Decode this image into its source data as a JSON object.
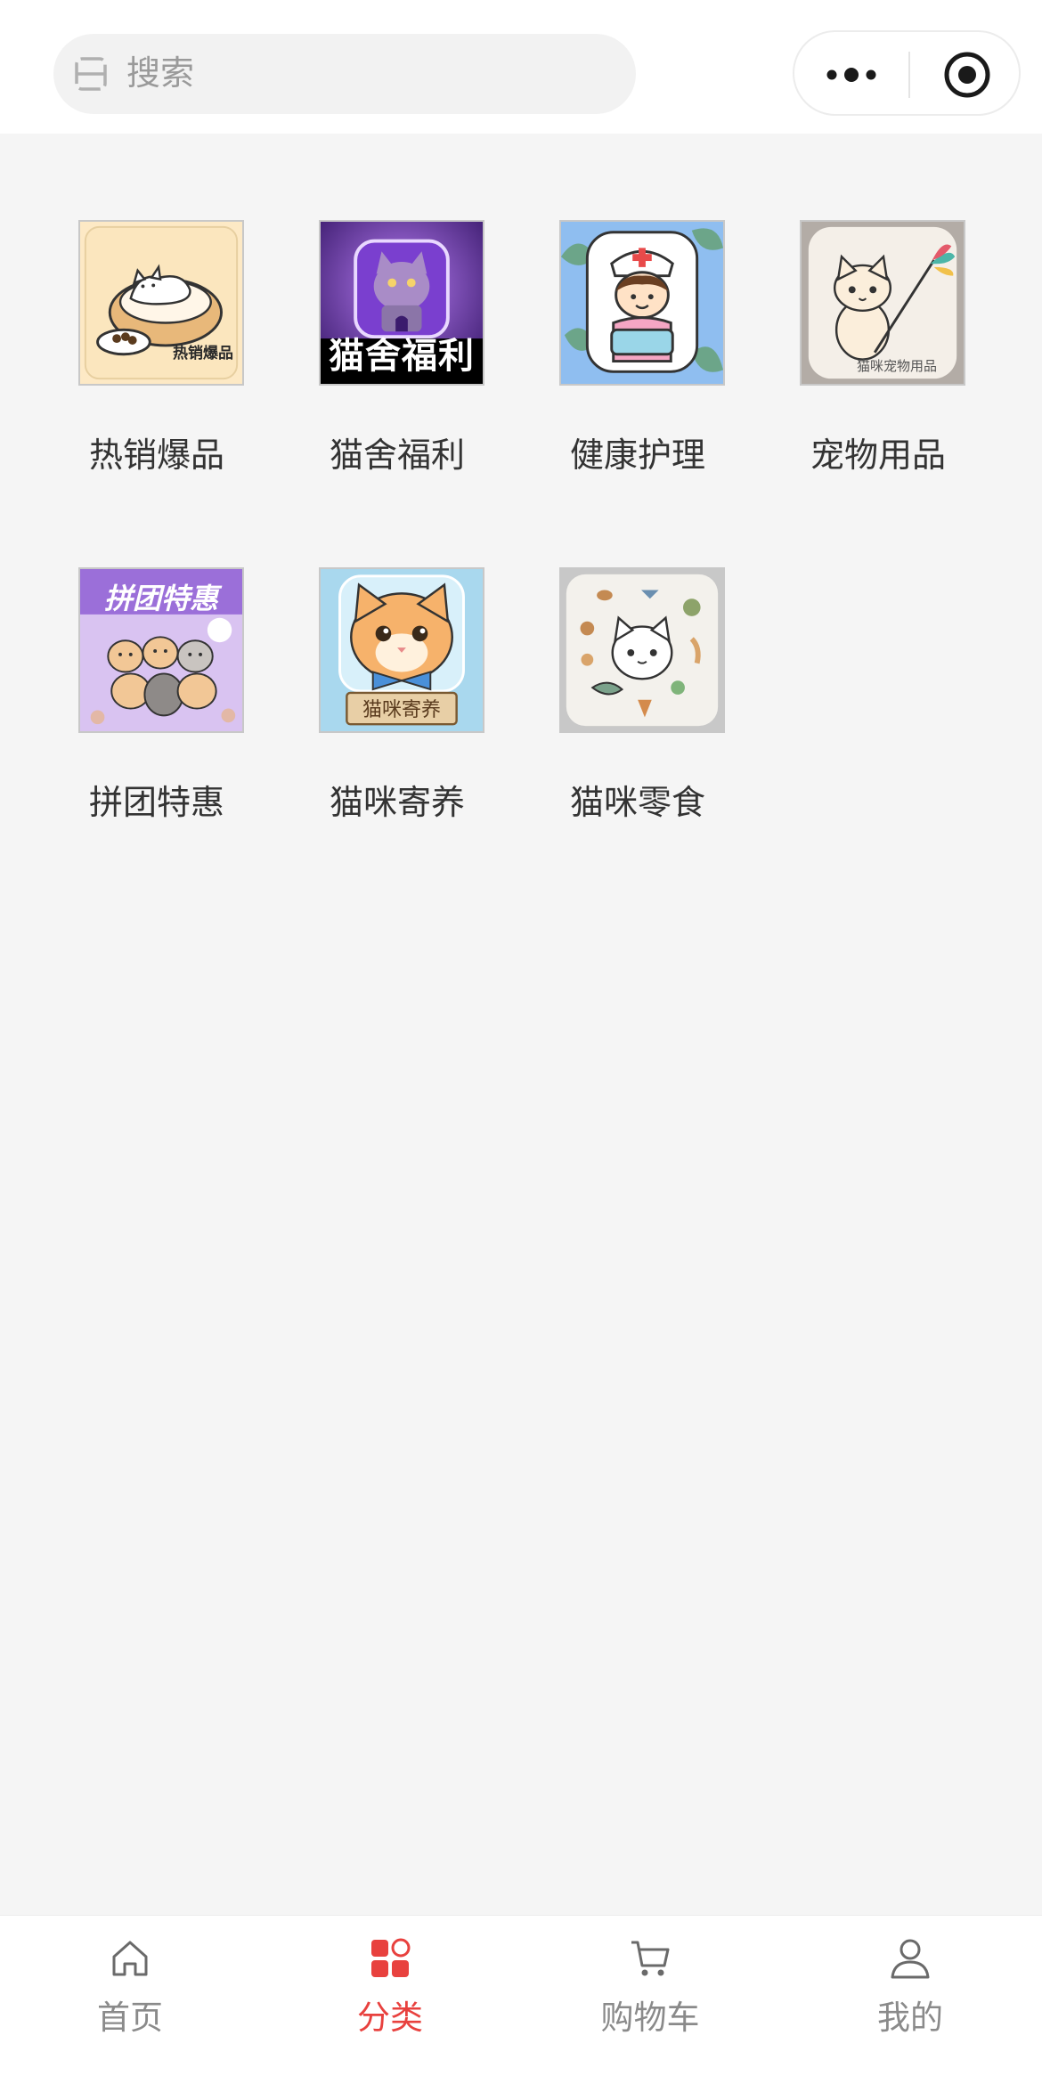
{
  "header": {
    "search": {
      "placeholder": "搜索"
    }
  },
  "categories": [
    {
      "label": "热销爆品",
      "icon": "cat-in-bed-image",
      "thumb_text": "热销爆品"
    },
    {
      "label": "猫舍福利",
      "icon": "purple-cat-house-image",
      "thumb_text": "猫舍福利"
    },
    {
      "label": "健康护理",
      "icon": "nurse-image"
    },
    {
      "label": "宠物用品",
      "icon": "cat-with-feather-toy-image",
      "thumb_text": "猫咪宠物用品"
    },
    {
      "label": "拼团特惠",
      "icon": "hamsters-image",
      "thumb_text": "拼团特惠"
    },
    {
      "label": "猫咪寄养",
      "icon": "orange-cat-bowtie-image",
      "thumb_text": "猫咪寄养"
    },
    {
      "label": "猫咪零食",
      "icon": "cat-with-snacks-image"
    }
  ],
  "bottom_nav": [
    {
      "label": "首页",
      "icon": "home-icon",
      "active": false
    },
    {
      "label": "分类",
      "icon": "category-icon",
      "active": true
    },
    {
      "label": "购物车",
      "icon": "cart-icon",
      "active": false
    },
    {
      "label": "我的",
      "icon": "user-icon",
      "active": false
    }
  ],
  "colors": {
    "accent": "#e8413e",
    "background": "#f5f5f5",
    "nav_inactive": "#8a8a8a"
  }
}
